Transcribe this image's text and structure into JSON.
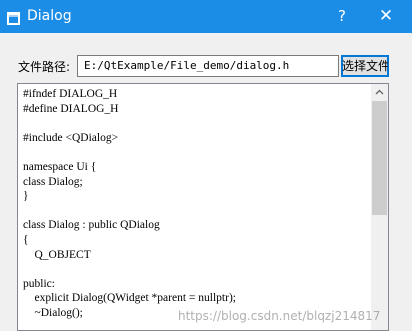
{
  "window": {
    "title": "Dialog",
    "help_glyph": "?",
    "close_glyph": "✕",
    "titlebar_color": "#1c8de6"
  },
  "form": {
    "path_label": "文件路径:",
    "path_value": "E:/QtExample/File_demo/dialog.h",
    "choose_button_label": "选择文件"
  },
  "editor": {
    "lines": [
      "#ifndef DIALOG_H",
      "#define DIALOG_H",
      "",
      "#include <QDialog>",
      "",
      "namespace Ui {",
      "class Dialog;",
      "}",
      "",
      "class Dialog : public QDialog",
      "{",
      "    Q_OBJECT",
      "",
      "public:",
      "    explicit Dialog(QWidget *parent = nullptr);",
      "    ~Dialog();"
    ]
  },
  "watermark": "https://blog.csdn.net/blqzj214817"
}
